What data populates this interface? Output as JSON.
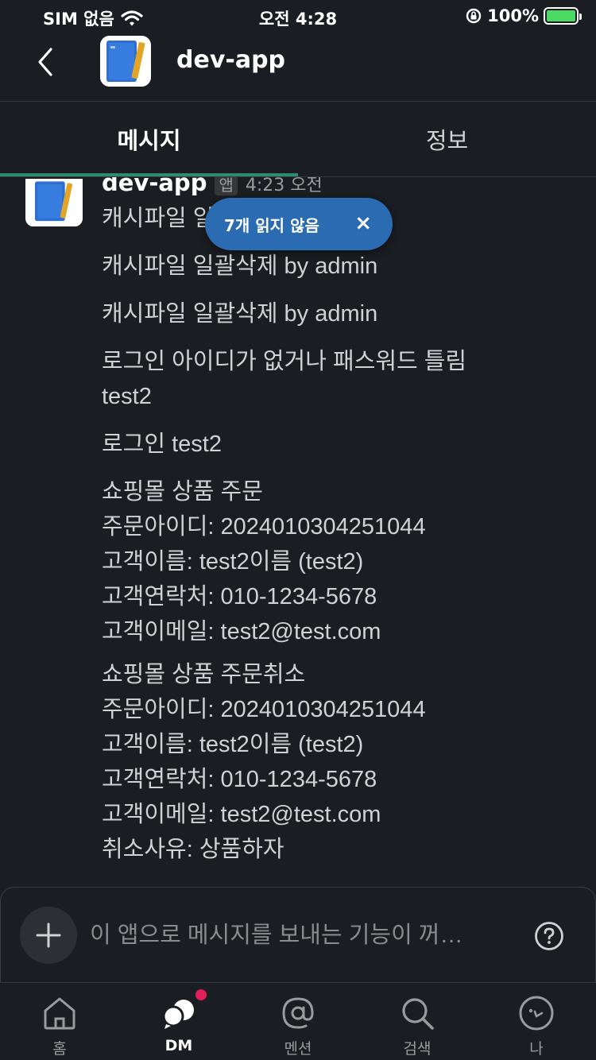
{
  "status_bar": {
    "carrier": "SIM 없음",
    "time": "오전 4:28",
    "battery": "100%"
  },
  "header": {
    "title": "dev-app",
    "app_icon": "blue-notebook-icon"
  },
  "tabs": [
    {
      "label": "메시지",
      "active": true
    },
    {
      "label": "정보",
      "active": false
    }
  ],
  "message": {
    "sender": "dev-app",
    "badge": "앱",
    "time": "4:23 오전",
    "lines": [
      "캐시파일 일괄삭제 by admin",
      "캐시파일 일괄삭제 by admin",
      "캐시파일 일괄삭제 by admin",
      "로그인 아이디가 없거나 패스워드 틀림\ntest2",
      "로그인 test2",
      "쇼핑몰 상품 주문\n주문아이디: 2024010304251044\n고객이름: test2이름 (test2)\n고객연락처: 010-1234-5678\n고객이메일: test2@test.com",
      "쇼핑몰 상품 주문취소\n주문아이디: 2024010304251044\n고객이름: test2이름 (test2)\n고객연락처: 010-1234-5678\n고객이메일: test2@test.com\n취소사유: 상품하자"
    ]
  },
  "unread_pill": {
    "label": "7개 읽지 않음",
    "close": "×"
  },
  "composer": {
    "placeholder": "이 앱으로 메시지를 보내는 기능이 꺼…"
  },
  "tab_bar": [
    {
      "label": "홈",
      "icon": "home-icon",
      "active": false
    },
    {
      "label": "DM",
      "icon": "dm-icon",
      "active": true,
      "has_notification": true
    },
    {
      "label": "멘션",
      "icon": "at-sign-icon",
      "active": false
    },
    {
      "label": "검색",
      "icon": "search-icon",
      "active": false
    },
    {
      "label": "나",
      "icon": "profile-icon",
      "active": false
    }
  ],
  "colors": {
    "background": "#1a1d21",
    "accent": "#2e8b6b",
    "pill": "#2a6bb2",
    "notification": "#e01e5a",
    "battery": "#4cd964"
  }
}
